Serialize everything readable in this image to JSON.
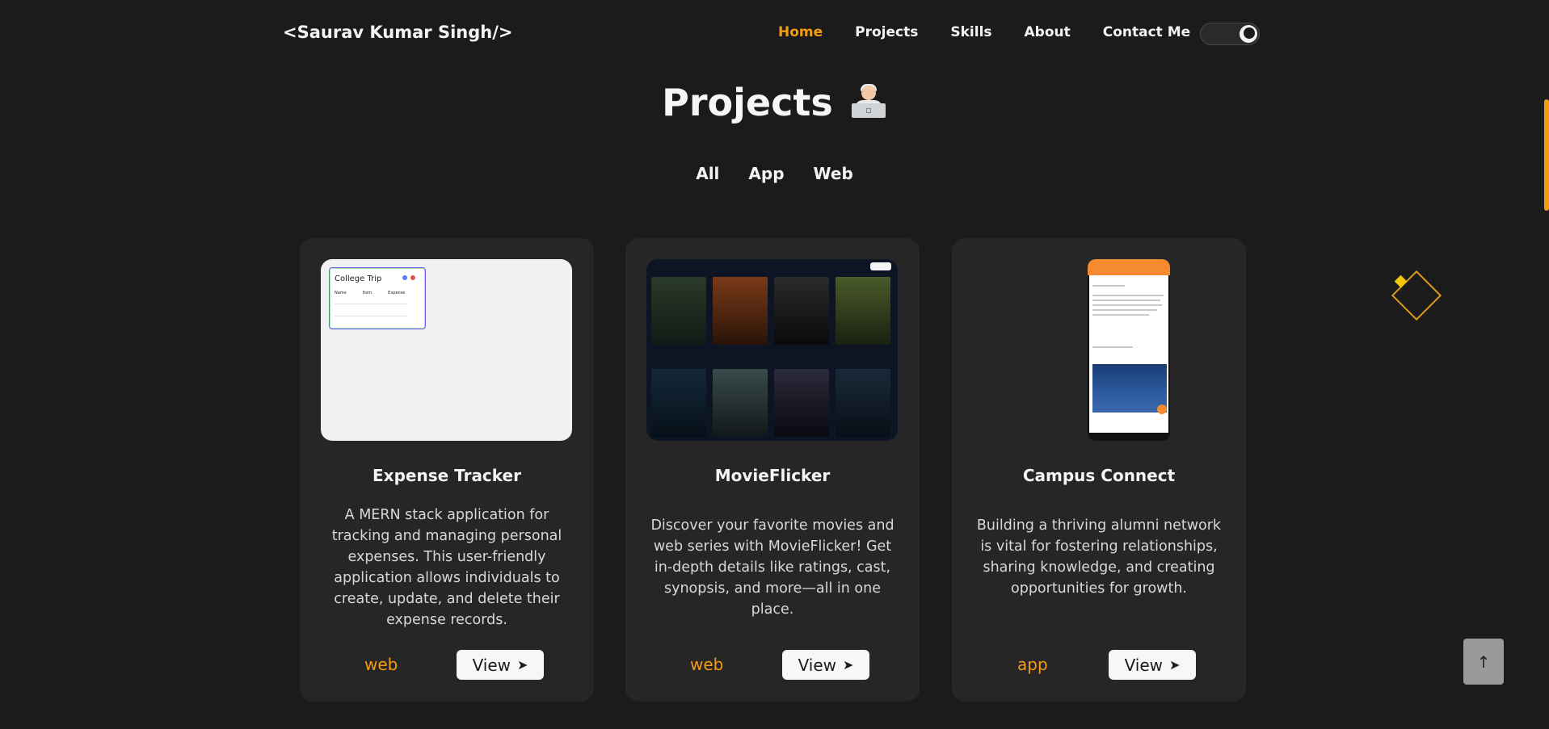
{
  "brand": "<Saurav Kumar Singh/>",
  "nav": {
    "items": [
      {
        "label": "Home",
        "active": true
      },
      {
        "label": "Projects",
        "active": false
      },
      {
        "label": "Skills",
        "active": false
      },
      {
        "label": "About",
        "active": false
      },
      {
        "label": "Contact Me",
        "active": false
      }
    ],
    "theme_icon": "moon-icon"
  },
  "heading": {
    "title": "Projects",
    "emoji": "technologist-emoji"
  },
  "filters": [
    "All",
    "App",
    "Web"
  ],
  "projects": [
    {
      "title": "Expense Tracker",
      "description": "A MERN stack application for tracking and managing personal expenses. This user-friendly application allows individuals to create, update, and delete their expense records.",
      "tag": "web",
      "view_label": "View",
      "preview": {
        "heading": "College Trip",
        "columns": [
          "Name",
          "Item",
          "Expense"
        ]
      }
    },
    {
      "title": "MovieFlicker",
      "description": "Discover your favorite movies and web series with MovieFlicker! Get in-depth details like ratings, cast, synopsis, and more—all in one place.",
      "tag": "web",
      "view_label": "View"
    },
    {
      "title": "Campus Connect",
      "description": "Building a thriving alumni network is vital for fostering relationships, sharing knowledge, and creating opportunities for growth.",
      "tag": "app",
      "view_label": "View"
    }
  ],
  "colors": {
    "accent": "#f39c12",
    "background": "#1b1b1b",
    "card": "#262626"
  },
  "scroll_top_icon": "arrow-up-icon"
}
